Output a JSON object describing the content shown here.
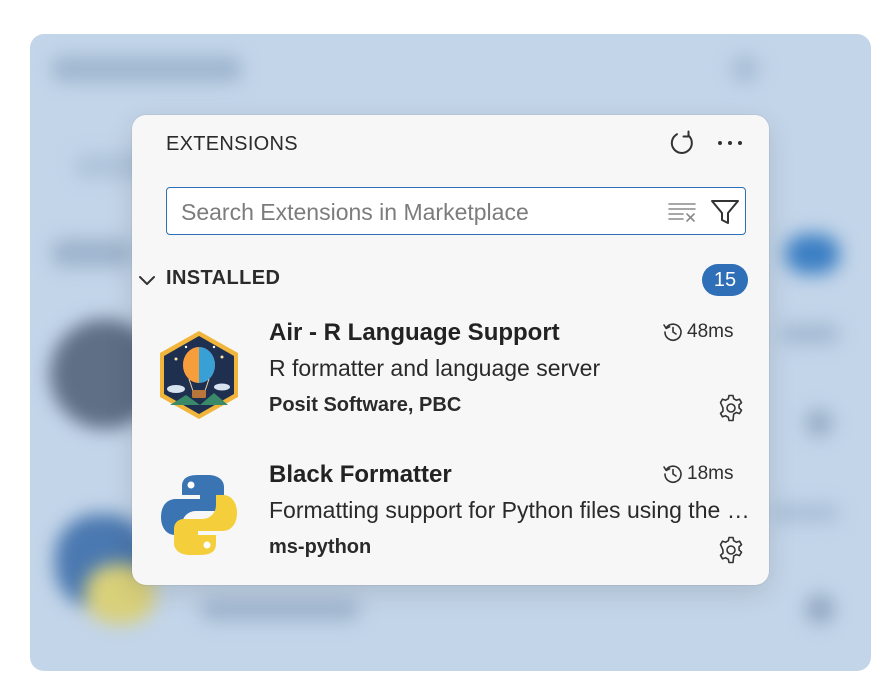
{
  "panel": {
    "title": "EXTENSIONS",
    "refresh_icon": "refresh-icon",
    "more_icon": "more-actions-icon"
  },
  "search": {
    "placeholder": "Search Extensions in Marketplace",
    "value": "",
    "clear_icon": "clear-search-icon",
    "filter_icon": "filter-icon"
  },
  "section": {
    "title": "INSTALLED",
    "count": "15",
    "chevron_icon": "chevron-down-icon"
  },
  "extensions": [
    {
      "name": "Air - R Language Support",
      "description": "R formatter and language server",
      "publisher": "Posit Software, PBC",
      "activation_time": "48ms",
      "icon": "air-balloon-logo"
    },
    {
      "name": "Black Formatter",
      "description": "Formatting support for Python files using the Black formatter.",
      "publisher": "ms-python",
      "activation_time": "18ms",
      "icon": "python-logo"
    }
  ],
  "colors": {
    "accent": "#2f6fb7",
    "backdrop": "#c3d5e9",
    "panel_bg": "#f7f7f7"
  }
}
